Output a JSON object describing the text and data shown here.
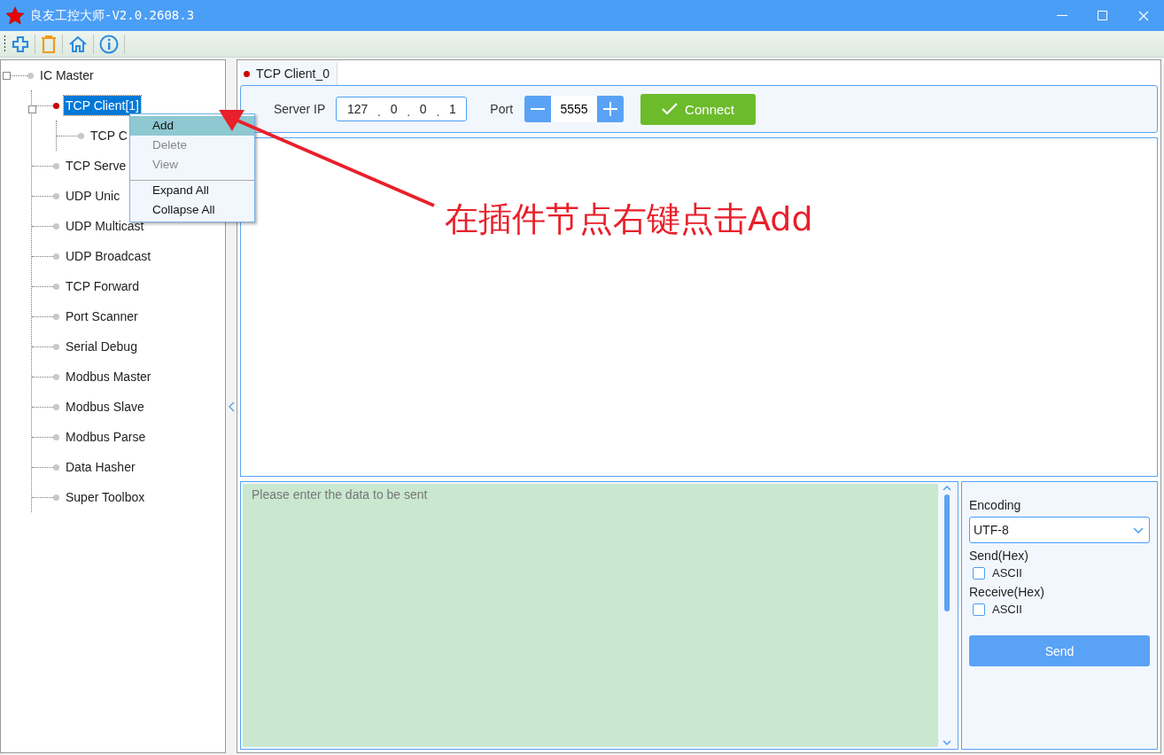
{
  "window": {
    "title": "良友工控大师-V2.0.2608.3"
  },
  "tree": [
    {
      "label": "IC Master",
      "selected": false,
      "color": "#c8c8c8",
      "children": [
        {
          "label": "TCP Client[1]",
          "selected": true,
          "color": "#cc0000",
          "children": [
            {
              "label": "TCP C",
              "selected": false,
              "color": "#c8c8c8"
            }
          ]
        },
        {
          "label": "TCP Serve",
          "selected": false,
          "color": "#c8c8c8"
        },
        {
          "label": "UDP Unic",
          "selected": false,
          "color": "#c8c8c8"
        },
        {
          "label": "UDP Multicast",
          "selected": false,
          "color": "#c8c8c8"
        },
        {
          "label": "UDP Broadcast",
          "selected": false,
          "color": "#c8c8c8"
        },
        {
          "label": "TCP Forward",
          "selected": false,
          "color": "#c8c8c8"
        },
        {
          "label": "Port Scanner",
          "selected": false,
          "color": "#c8c8c8"
        },
        {
          "label": "Serial Debug",
          "selected": false,
          "color": "#c8c8c8"
        },
        {
          "label": "Modbus Master",
          "selected": false,
          "color": "#c8c8c8"
        },
        {
          "label": "Modbus Slave",
          "selected": false,
          "color": "#c8c8c8"
        },
        {
          "label": "Modbus Parse",
          "selected": false,
          "color": "#c8c8c8"
        },
        {
          "label": "Data Hasher",
          "selected": false,
          "color": "#c8c8c8"
        },
        {
          "label": "Super Toolbox",
          "selected": false,
          "color": "#c8c8c8"
        }
      ]
    }
  ],
  "context_menu": [
    {
      "label": "Add",
      "selected": true,
      "disabled": false,
      "separator_before": false
    },
    {
      "label": "Delete",
      "selected": false,
      "disabled": true,
      "separator_before": false
    },
    {
      "label": "View",
      "selected": false,
      "disabled": true,
      "separator_before": false
    },
    {
      "label": "Expand All",
      "selected": false,
      "disabled": false,
      "separator_before": true
    },
    {
      "label": "Collapse All",
      "selected": false,
      "disabled": false,
      "separator_before": false
    }
  ],
  "tabs": [
    {
      "label": "TCP Client_0",
      "selected": true,
      "color": "#cc0000"
    }
  ],
  "connection": {
    "server_ip_label": "Server IP",
    "octets": [
      "127",
      "0",
      "0",
      "1"
    ],
    "separators": [
      ".",
      ".",
      "."
    ],
    "port_label": "Port",
    "port": "5555",
    "connect": "Connect"
  },
  "send_area": {
    "placeholder": "Please enter the data to be sent"
  },
  "options": {
    "encoding_label": "Encoding",
    "encoding": "UTF-8",
    "send_hex_label": "Send(Hex)",
    "send_ascii": {
      "label": "ASCII",
      "checked": false
    },
    "receive_hex_label": "Receive(Hex)",
    "receive_ascii": {
      "label": "ASCII",
      "checked": false
    },
    "send_button": "Send"
  },
  "annotation": {
    "text": "在插件节点右键点击Add"
  }
}
